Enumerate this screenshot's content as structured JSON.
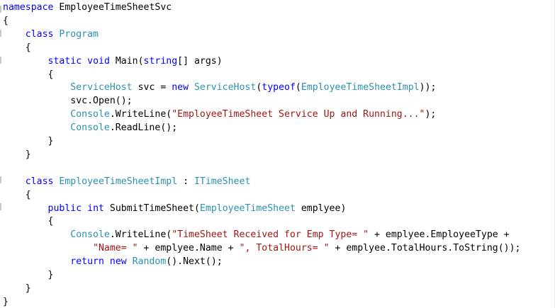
{
  "editor": {
    "colors": {
      "keyword": "#0000ff",
      "type": "#2b91af",
      "string": "#a31515",
      "plain": "#000000",
      "background": "#ffffff"
    },
    "lines": [
      [
        {
          "t": "namespace",
          "c": "kw"
        },
        {
          "t": " EmployeeTimeSheetSvc",
          "c": "pl"
        }
      ],
      [
        {
          "t": "{",
          "c": "pl"
        }
      ],
      [
        {
          "t": "    ",
          "c": "pl"
        },
        {
          "t": "class",
          "c": "kw"
        },
        {
          "t": " ",
          "c": "pl"
        },
        {
          "t": "Program",
          "c": "typ"
        }
      ],
      [
        {
          "t": "    {",
          "c": "pl"
        }
      ],
      [
        {
          "t": "        ",
          "c": "pl"
        },
        {
          "t": "static",
          "c": "kw"
        },
        {
          "t": " ",
          "c": "pl"
        },
        {
          "t": "void",
          "c": "kw"
        },
        {
          "t": " Main(",
          "c": "pl"
        },
        {
          "t": "string",
          "c": "kw"
        },
        {
          "t": "[] args)",
          "c": "pl"
        }
      ],
      [
        {
          "t": "        {",
          "c": "pl"
        }
      ],
      [
        {
          "t": "            ",
          "c": "pl"
        },
        {
          "t": "ServiceHost",
          "c": "typ"
        },
        {
          "t": " svc = ",
          "c": "pl"
        },
        {
          "t": "new",
          "c": "kw"
        },
        {
          "t": " ",
          "c": "pl"
        },
        {
          "t": "ServiceHost",
          "c": "typ"
        },
        {
          "t": "(",
          "c": "pl"
        },
        {
          "t": "typeof",
          "c": "kw"
        },
        {
          "t": "(",
          "c": "pl"
        },
        {
          "t": "EmployeeTimeSheetImpl",
          "c": "typ"
        },
        {
          "t": "));",
          "c": "pl"
        }
      ],
      [
        {
          "t": "            svc.Open();",
          "c": "pl"
        }
      ],
      [
        {
          "t": "            ",
          "c": "pl"
        },
        {
          "t": "Console",
          "c": "typ"
        },
        {
          "t": ".WriteLine(",
          "c": "pl"
        },
        {
          "t": "\"EmployeeTimeSheet Service Up and Running...\"",
          "c": "str"
        },
        {
          "t": ");",
          "c": "pl"
        }
      ],
      [
        {
          "t": "            ",
          "c": "pl"
        },
        {
          "t": "Console",
          "c": "typ"
        },
        {
          "t": ".ReadLine();",
          "c": "pl"
        }
      ],
      [
        {
          "t": "        }",
          "c": "pl"
        }
      ],
      [
        {
          "t": "    }",
          "c": "pl"
        }
      ],
      [],
      [
        {
          "t": "    ",
          "c": "pl"
        },
        {
          "t": "class",
          "c": "kw"
        },
        {
          "t": " ",
          "c": "pl"
        },
        {
          "t": "EmployeeTimeSheetImpl",
          "c": "typ"
        },
        {
          "t": " : ",
          "c": "pl"
        },
        {
          "t": "ITimeSheet",
          "c": "typ"
        }
      ],
      [
        {
          "t": "    {",
          "c": "pl"
        }
      ],
      [
        {
          "t": "        ",
          "c": "pl"
        },
        {
          "t": "public",
          "c": "kw"
        },
        {
          "t": " ",
          "c": "pl"
        },
        {
          "t": "int",
          "c": "kw"
        },
        {
          "t": " SubmitTimeSheet(",
          "c": "pl"
        },
        {
          "t": "EmployeeTimeSheet",
          "c": "typ"
        },
        {
          "t": " emplyee)",
          "c": "pl"
        }
      ],
      [
        {
          "t": "        {",
          "c": "pl"
        }
      ],
      [
        {
          "t": "            ",
          "c": "pl"
        },
        {
          "t": "Console",
          "c": "typ"
        },
        {
          "t": ".WriteLine(",
          "c": "pl"
        },
        {
          "t": "\"TimeSheet Received for Emp Type= \"",
          "c": "str"
        },
        {
          "t": " + emplyee.EmployeeType +",
          "c": "pl"
        }
      ],
      [
        {
          "t": "                ",
          "c": "pl"
        },
        {
          "t": "\"Name= \"",
          "c": "str"
        },
        {
          "t": " + emplyee.Name + ",
          "c": "pl"
        },
        {
          "t": "\", TotalHours= \"",
          "c": "str"
        },
        {
          "t": " + emplyee.TotalHours.ToString());",
          "c": "pl"
        }
      ],
      [
        {
          "t": "            ",
          "c": "pl"
        },
        {
          "t": "return",
          "c": "kw"
        },
        {
          "t": " ",
          "c": "pl"
        },
        {
          "t": "new",
          "c": "kw"
        },
        {
          "t": " ",
          "c": "pl"
        },
        {
          "t": "Random",
          "c": "typ"
        },
        {
          "t": "().Next();",
          "c": "pl"
        }
      ],
      [
        {
          "t": "        }",
          "c": "pl"
        }
      ],
      [
        {
          "t": "    }",
          "c": "pl"
        }
      ],
      [
        {
          "t": "}",
          "c": "pl"
        }
      ]
    ]
  }
}
